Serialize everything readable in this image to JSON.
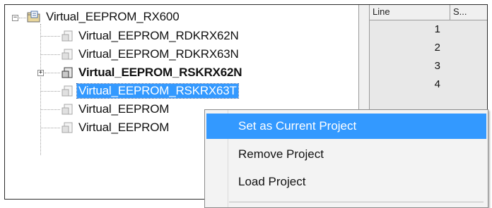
{
  "tree": {
    "root": {
      "label": "Virtual_EEPROM_RX600",
      "expander": "⊟"
    },
    "items": [
      {
        "label": "Virtual_EEPROM_RDKRX62N",
        "expander": ""
      },
      {
        "label": "Virtual_EEPROM_RDKRX63N",
        "expander": ""
      },
      {
        "label": "Virtual_EEPROM_RSKRX62N",
        "expander": "+"
      },
      {
        "label": "Virtual_EEPROM_RSKRX63T",
        "expander": ""
      },
      {
        "label": "Virtual_EEPROM",
        "expander": ""
      },
      {
        "label": "Virtual_EEPROM",
        "expander": ""
      }
    ]
  },
  "grid": {
    "headers": [
      "Line",
      "S..."
    ],
    "line_numbers": [
      "1",
      "2",
      "3",
      "4"
    ]
  },
  "context_menu": {
    "items": [
      {
        "label": "Set as Current Project"
      },
      {
        "label": "Remove Project"
      },
      {
        "label": "Load Project"
      }
    ]
  },
  "colors": {
    "selection": "#3399ff",
    "menu_background": "#f3f3f3"
  }
}
